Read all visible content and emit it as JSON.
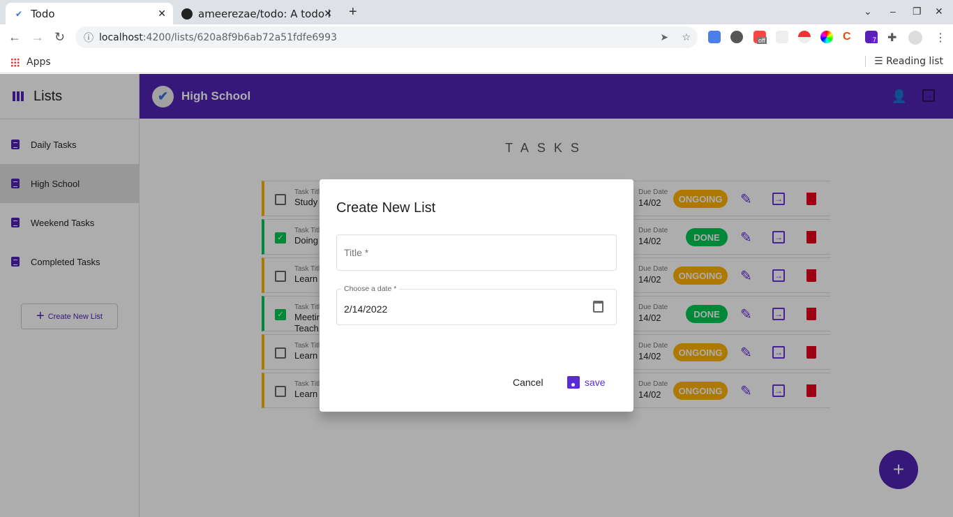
{
  "browser": {
    "tabs": [
      {
        "title": "Todo"
      },
      {
        "title": "ameerezae/todo: A todo l"
      }
    ],
    "url_host": "localhost",
    "url_path": ":4200/lists/620a8f9b6ab72a51fdfe6993",
    "bookmarks": {
      "apps": "Apps",
      "reading_list": "Reading list"
    },
    "extension_badge": "7",
    "extension_off": "off"
  },
  "sidebar": {
    "title": "Lists",
    "items": [
      {
        "label": "Daily Tasks"
      },
      {
        "label": "High School",
        "selected": true
      },
      {
        "label": "Weekend Tasks"
      },
      {
        "label": "Completed Tasks"
      }
    ],
    "create_button": "Create New List"
  },
  "header": {
    "title": "High School"
  },
  "main": {
    "heading": "TASKS",
    "task_label": "Task Title",
    "due_label": "Due Date",
    "tasks": [
      {
        "title": "Study",
        "due": "14/02",
        "status": "ONGOING",
        "done": false
      },
      {
        "title": "Doing",
        "due": "14/02",
        "status": "DONE",
        "done": true
      },
      {
        "title": "Learn",
        "due": "14/02",
        "status": "ONGOING",
        "done": false
      },
      {
        "title": "Meeting Teach",
        "due": "14/02",
        "status": "DONE",
        "done": true
      },
      {
        "title": "Learn",
        "due": "14/02",
        "status": "ONGOING",
        "done": false
      },
      {
        "title": "Learn",
        "due": "14/02",
        "status": "ONGOING",
        "done": false
      }
    ]
  },
  "dialog": {
    "title": "Create New List",
    "title_placeholder": "Title *",
    "date_label": "Choose a date *",
    "date_value": "2/14/2022",
    "cancel": "Cancel",
    "save": "save"
  },
  "colors": {
    "primary": "#5023b4",
    "ongoing": "#ffb300",
    "done": "#00c853",
    "delete": "#e8001c"
  }
}
